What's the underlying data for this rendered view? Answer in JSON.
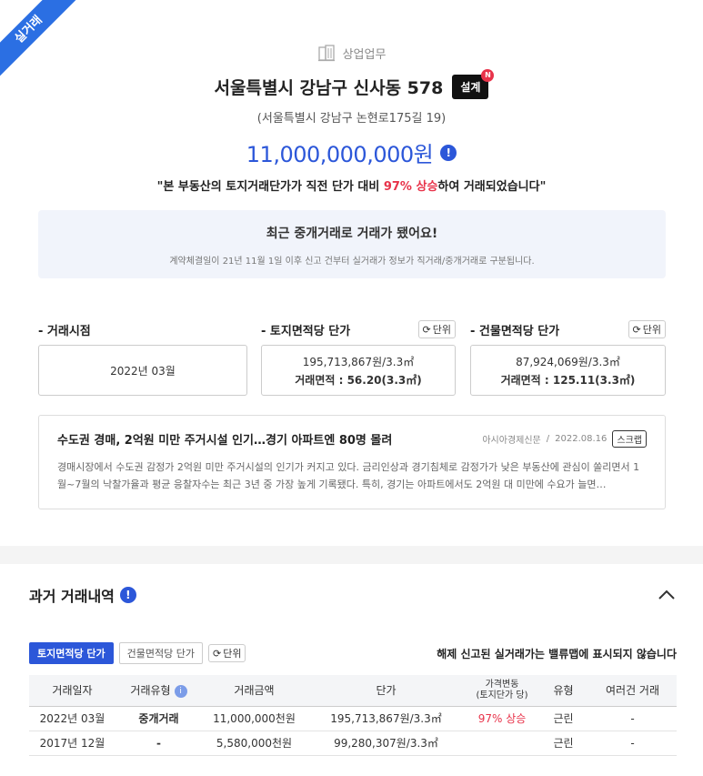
{
  "ribbon": "실거래",
  "header": {
    "category": "상업업무",
    "address": "서울특별시 강남구 신사동 578",
    "badge": "설계",
    "badge_new": "N",
    "road_address": "(서울특별시 강남구 논현로175길 19)",
    "price": "11,000,000,000원",
    "info_symbol": "!",
    "quote_before": "\"본 부동산의 토지거래단가가 직전 단가 대비 ",
    "quote_highlight": "97% 상승",
    "quote_after": "하여 거래되었습니다\""
  },
  "notice": {
    "title": "최근 중개거래로 거래가 됐어요!",
    "desc": "계약체결일이 21년 11월 1일 이후 신고 건부터 실거래가 정보가 직거래/중개거래로 구분됩니다."
  },
  "metrics": {
    "unit_label": "단위",
    "deal_date": {
      "label": "- 거래시점",
      "value": "2022년 03월"
    },
    "land": {
      "label": "- 토지면적당 단가",
      "price": "195,713,867원/3.3㎡",
      "area": "거래면적 : 56.20(3.3㎡)"
    },
    "building": {
      "label": "- 건물면적당 단가",
      "price": "87,924,069원/3.3㎡",
      "area": "거래면적 : 125.11(3.3㎡)"
    }
  },
  "news": {
    "title": "수도권 경매, 2억원 미만 주거시설 인기…경기 아파트엔 80명 몰려",
    "source": "아시아경제신문",
    "sep": "/",
    "date": "2022.08.16",
    "scrap": "스크랩",
    "body": "경매시장에서 수도권 감정가 2억원 미만 주거시설의 인기가 커지고 있다. 금리인상과 경기침체로 감정가가 낮은 부동산에 관심이 쏠리면서 1월~7월의 낙찰가율과 평균 응찰자수는 최근 3년 중 가장 높게 기록됐다. 특히, 경기는 아파트에서도 2억원 대 미만에 수요가 늘면…"
  },
  "history": {
    "title": "과거 거래내역",
    "tab_land": "토지면적당 단가",
    "tab_building": "건물면적당 단가",
    "unit": "단위",
    "note": "해제 신고된 실거래가는 밸류맵에 표시되지 않습니다",
    "columns": {
      "date": "거래일자",
      "type": "거래유형",
      "amount": "거래금액",
      "unit_price": "단가",
      "change1": "가격변동",
      "change2": "(토지단가 당)",
      "kind": "유형",
      "multi": "여러건 거래"
    },
    "type_info": "i",
    "rows": [
      {
        "date": "2022년 03월",
        "type": "중개거래",
        "amount": "11,000,000천원",
        "unit_price": "195,713,867원/3.3㎡",
        "change": "97% 상승",
        "kind": "근린",
        "multi": "-"
      },
      {
        "date": "2017년 12월",
        "type": "-",
        "amount": "5,580,000천원",
        "unit_price": "99,280,307원/3.3㎡",
        "change": "",
        "kind": "근린",
        "multi": "-"
      }
    ]
  },
  "colors": {
    "primary": "#2c57d9",
    "highlight": "#e8334a",
    "ribbon": "#2b6fe3"
  }
}
